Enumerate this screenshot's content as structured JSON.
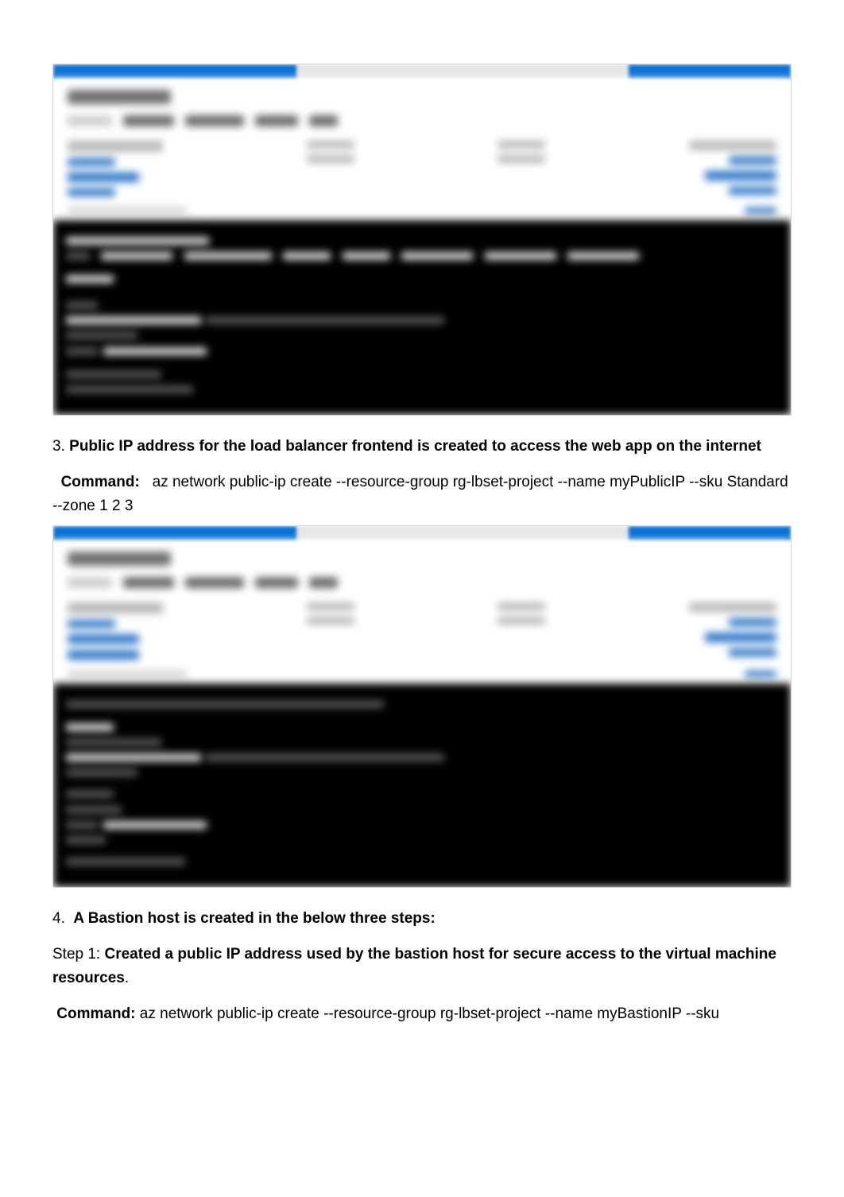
{
  "section3": {
    "number": "3.",
    "title": "Public IP address for the load balancer frontend is created to access the web app on the internet",
    "command_label": "Command:",
    "command": "az network public-ip create --resource-group rg-lbset-project --name myPublicIP --sku Standard --zone 1 2 3"
  },
  "section4": {
    "number": "4.",
    "title": "A Bastion host is created in the below three steps:",
    "step1_prefix": "Step 1:",
    "step1_text": "Created a public IP address used by the bastion host for secure access to the virtual machine resources",
    "step1_suffix": ".",
    "command_label": "Command:",
    "command": "az network public-ip create --resource-group rg-lbset-project --name myBastionIP --sku"
  }
}
